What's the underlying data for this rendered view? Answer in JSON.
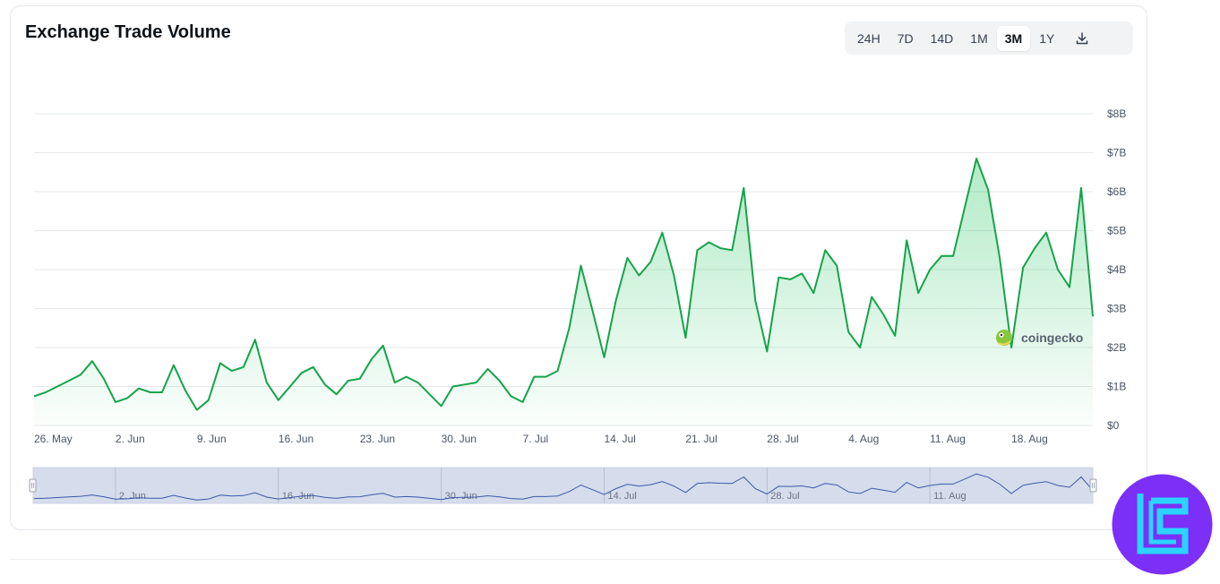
{
  "title": "Exchange Trade Volume",
  "time_ranges": [
    {
      "label": "24H",
      "active": false
    },
    {
      "label": "7D",
      "active": false
    },
    {
      "label": "14D",
      "active": false
    },
    {
      "label": "1M",
      "active": false
    },
    {
      "label": "3M",
      "active": true
    },
    {
      "label": "1Y",
      "active": false
    }
  ],
  "download_icon": "download-icon",
  "watermark": "coingecko",
  "colors": {
    "line": "#16a34a",
    "area_top": "#22c55e",
    "navigator_fill": "#c7d0e4",
    "navigator_line": "#3b5aa6",
    "grid": "#e5e7eb",
    "brand_purple": "#7b2ff7",
    "brand_cyan": "#2ad4ff"
  },
  "chart_data": {
    "type": "area",
    "title": "Exchange Trade Volume",
    "xlabel": "",
    "ylabel": "",
    "x_start": "2025-05-26",
    "x_tick_labels": [
      "26. May",
      "2. Jun",
      "9. Jun",
      "16. Jun",
      "23. Jun",
      "30. Jun",
      "7. Jul",
      "14. Jul",
      "21. Jul",
      "28. Jul",
      "4. Aug",
      "11. Aug",
      "18. Aug"
    ],
    "navigator_labels": [
      "2. Jun",
      "16. Jun",
      "30. Jun",
      "14. Jul",
      "28. Jul",
      "11. Aug"
    ],
    "y_tick_labels": [
      "$0",
      "$1B",
      "$2B",
      "$3B",
      "$4B",
      "$5B",
      "$6B",
      "$7B",
      "$8B"
    ],
    "ylim": [
      0,
      8
    ],
    "y_unit": "billions USD",
    "grid": true,
    "legend": "none",
    "series": [
      {
        "values": [
          0.75,
          0.85,
          1.0,
          1.15,
          1.3,
          1.65,
          1.2,
          0.6,
          0.7,
          0.95,
          0.85,
          0.85,
          1.55,
          0.9,
          0.4,
          0.65,
          1.6,
          1.4,
          1.5,
          2.2,
          1.1,
          0.65,
          1.0,
          1.35,
          1.5,
          1.05,
          0.8,
          1.15,
          1.2,
          1.7,
          2.05,
          1.1,
          1.25,
          1.1,
          0.8,
          0.5,
          1.0,
          1.05,
          1.1,
          1.45,
          1.15,
          0.75,
          0.6,
          1.25,
          1.25,
          1.4,
          2.5,
          4.1,
          2.95,
          1.75,
          3.2,
          4.3,
          3.85,
          4.2,
          4.95,
          3.85,
          2.25,
          4.5,
          4.7,
          4.55,
          4.5,
          6.1,
          3.2,
          1.9,
          3.8,
          3.75,
          3.9,
          3.4,
          4.5,
          4.1,
          2.4,
          2.0,
          3.3,
          2.85,
          2.3,
          4.75,
          3.4,
          4.0,
          4.35,
          4.35,
          5.6,
          6.85,
          6.05,
          4.3,
          2.0,
          4.05,
          4.55,
          4.95,
          4.0,
          3.55,
          6.1,
          2.8
        ]
      }
    ]
  }
}
